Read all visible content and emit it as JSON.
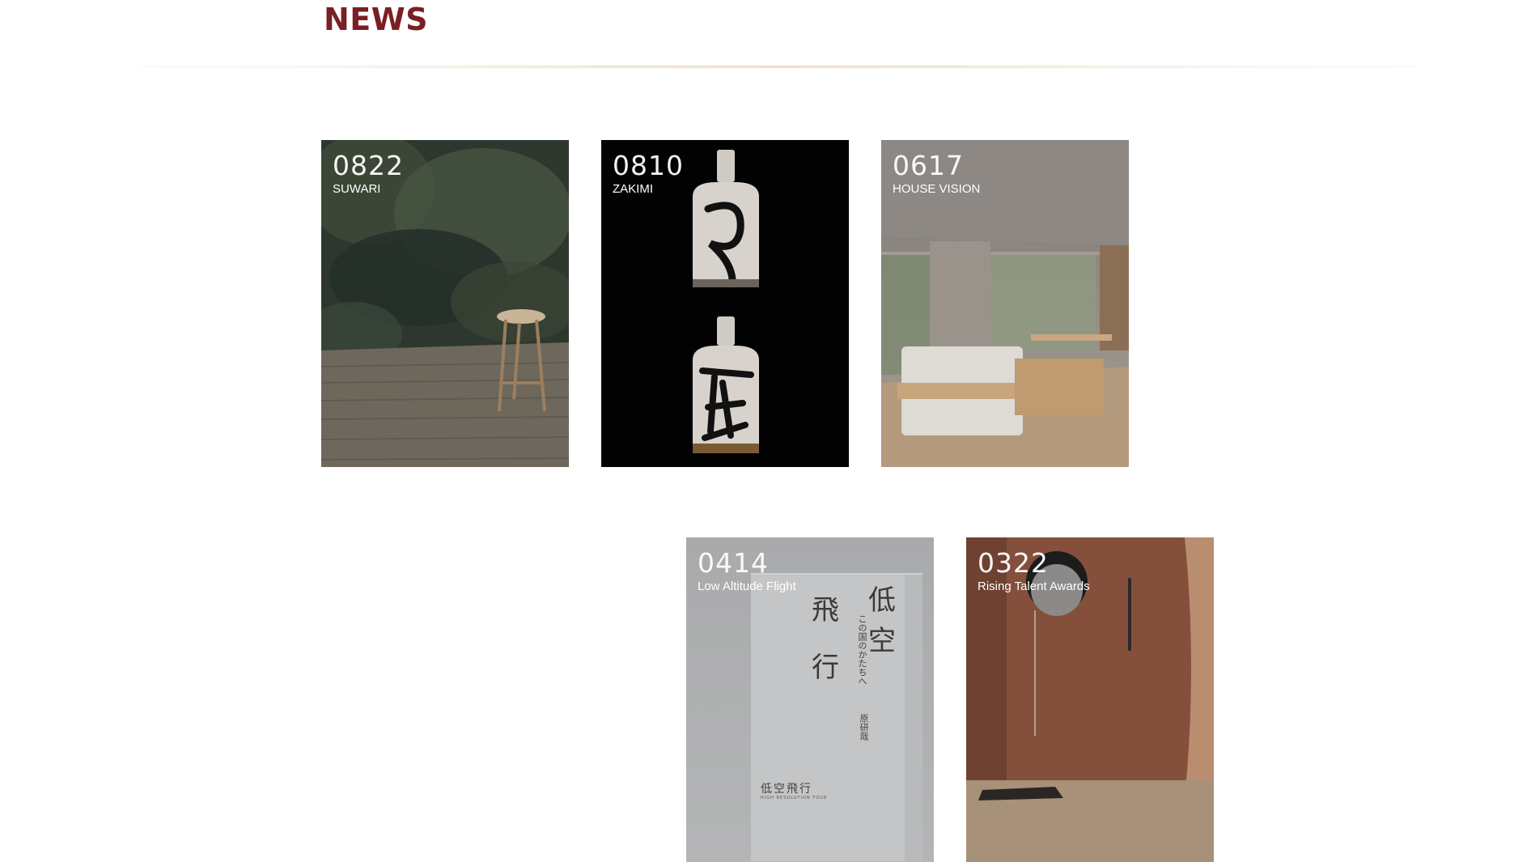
{
  "page": {
    "title": "NEWS"
  },
  "cards": [
    {
      "date": "0822",
      "label": "SUWARI"
    },
    {
      "date": "0810",
      "label": "ZAKIMI"
    },
    {
      "date": "0617",
      "label": "HOUSE VISION"
    },
    {
      "date": "0414",
      "label": "Low Altitude Flight"
    },
    {
      "date": "0322",
      "label": "Rising Talent Awards"
    }
  ],
  "book_cover": {
    "title_chars": [
      "低",
      "空",
      "飛",
      "行"
    ],
    "subtitle": "この国のかたちへ",
    "author": "原研哉",
    "series": "低空飛行",
    "series_en": "HIGH RESOLUTION TOUR"
  },
  "colors": {
    "title": "#7a1f24",
    "card_text": "#ffffff"
  }
}
